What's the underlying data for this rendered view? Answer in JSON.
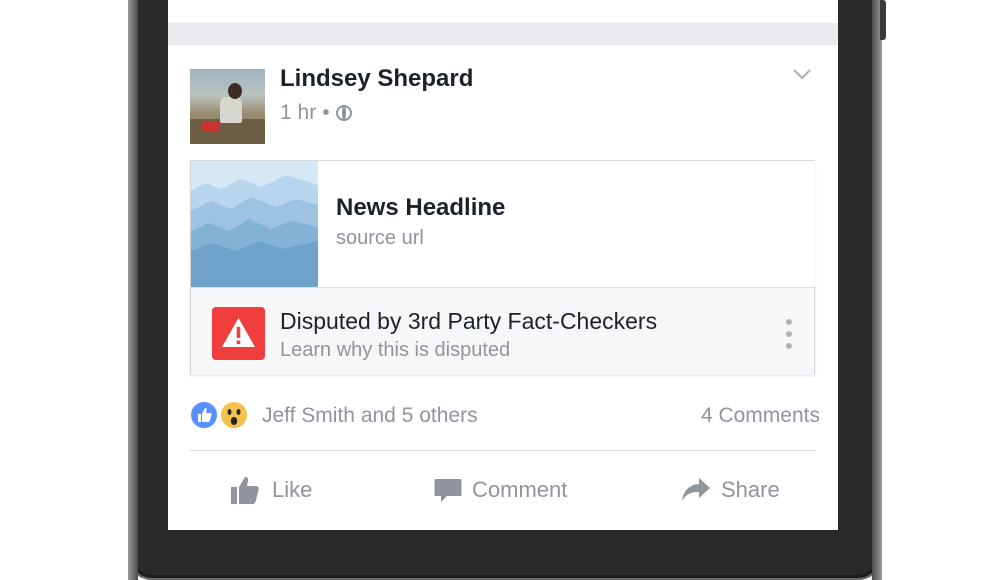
{
  "post": {
    "author": "Lindsey Shepard",
    "time": "1 hr",
    "separator": "•"
  },
  "link_preview": {
    "headline": "News Headline",
    "source": "source url"
  },
  "dispute": {
    "title": "Disputed by 3rd Party Fact-Checkers",
    "link": "Learn why this is disputed"
  },
  "engagement": {
    "reactions_text": "Jeff Smith and 5 others",
    "comments_text": "4 Comments"
  },
  "actions": {
    "like_label": "Like",
    "comment_label": "Comment",
    "share_label": "Share"
  },
  "colors": {
    "text": "#1d2129",
    "secondary": "#90949c",
    "warning": "#f03e3e",
    "like_blue": "#5890ff",
    "wow_yellow": "#f7c14e",
    "feed_bg": "#e9ebee"
  },
  "icons": [
    "chevron-down-icon",
    "globe-icon",
    "warning-icon",
    "more-vertical-icon",
    "like-reaction-icon",
    "wow-reaction-icon",
    "thumbs-up-icon",
    "comment-icon",
    "share-icon"
  ]
}
